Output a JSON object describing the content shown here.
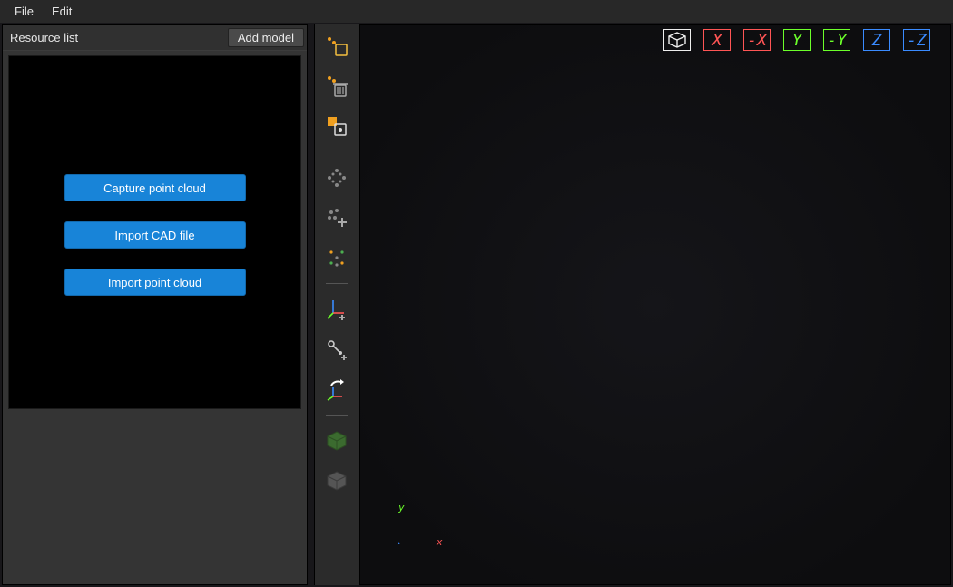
{
  "menu": {
    "file": "File",
    "edit": "Edit"
  },
  "resource_panel": {
    "title": "Resource list",
    "add_model": "Add model",
    "buttons": {
      "capture": "Capture point cloud",
      "import_cad": "Import CAD file",
      "import_pc": "Import point cloud"
    }
  },
  "vertical_toolbar": {
    "items": [
      "select-rect-tool",
      "delete-tool",
      "selection-mask-tool",
      "scatter-points-tool",
      "add-points-tool",
      "cluster-points-tool",
      "add-frame-tool",
      "add-anchor-tool",
      "transform-frame-tool",
      "voxel-green-tool",
      "voxel-gray-tool"
    ]
  },
  "view_controls": {
    "iso": "iso",
    "xp": "X",
    "xn": "-X",
    "yp": "Y",
    "yn": "-Y",
    "zp": "Z",
    "zn": "-Z"
  },
  "gizmo": {
    "x": "x",
    "y": "y"
  },
  "colors": {
    "accent_blue": "#1884d8",
    "axis_x": "#ff5555",
    "axis_y": "#6cff2a",
    "axis_z": "#3a8bff"
  }
}
